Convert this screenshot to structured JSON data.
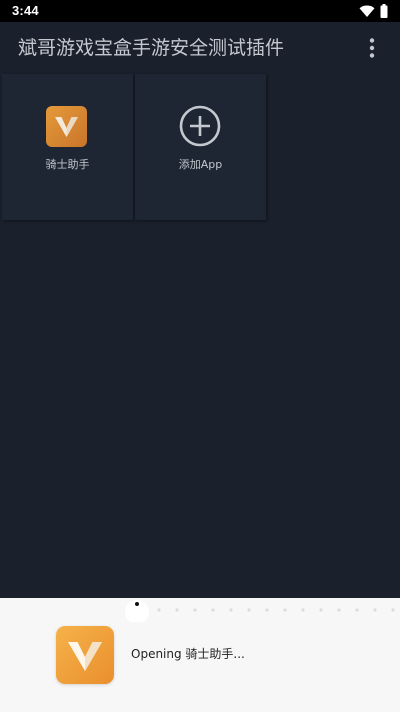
{
  "status_bar": {
    "time": "3:44",
    "icons": [
      "wifi-icon",
      "battery-icon"
    ]
  },
  "toolbar": {
    "title": "斌哥游戏宝盒手游安全测试插件",
    "menu_icon": "more-vert-icon"
  },
  "tiles": [
    {
      "label": "骑士助手",
      "icon": "knight-assistant-app-icon"
    },
    {
      "label": "添加App",
      "icon": "add-circle-icon"
    }
  ],
  "launch_sheet": {
    "text": "Opening 骑士助手...",
    "icon": "knight-assistant-app-icon",
    "progress": {
      "active_dot_index": 0
    }
  },
  "colors": {
    "background": "#1a202c",
    "tile": "#1e2533",
    "text": "#c4c8cf",
    "status_bar": "#000000",
    "sheet": "#f7f7f7",
    "app_icon_orange": "#e98f2d"
  }
}
